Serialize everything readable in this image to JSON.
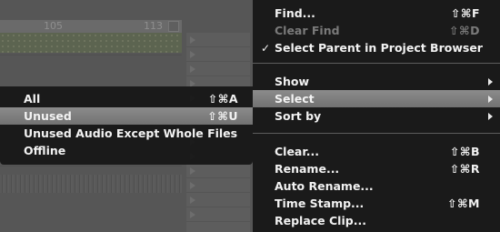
{
  "background": {
    "ruler_labels": [
      "105",
      "113"
    ]
  },
  "main_menu": {
    "items": [
      {
        "label": "Find...",
        "shortcut": "⇧⌘F"
      },
      {
        "label": "Clear Find",
        "shortcut": "⇧⌘D"
      },
      {
        "label": "Select Parent in Project Browser",
        "check": "✓"
      },
      {
        "label": "Show"
      },
      {
        "label": "Select"
      },
      {
        "label": "Sort by"
      },
      {
        "label": "Clear...",
        "shortcut": "⇧⌘B"
      },
      {
        "label": "Rename...",
        "shortcut": "⇧⌘R"
      },
      {
        "label": "Auto Rename..."
      },
      {
        "label": "Time Stamp...",
        "shortcut": "⇧⌘M"
      },
      {
        "label": "Replace Clip..."
      }
    ]
  },
  "submenu": {
    "items": [
      {
        "label": "All",
        "shortcut": "⇧⌘A"
      },
      {
        "label": "Unused",
        "shortcut": "⇧⌘U"
      },
      {
        "label": "Unused Audio Except Whole Files"
      },
      {
        "label": "Offline"
      }
    ]
  },
  "colors": {
    "menu_bg": "#161616",
    "highlight": "#7f7f7f",
    "disabled_text": "#7a7a7a"
  }
}
